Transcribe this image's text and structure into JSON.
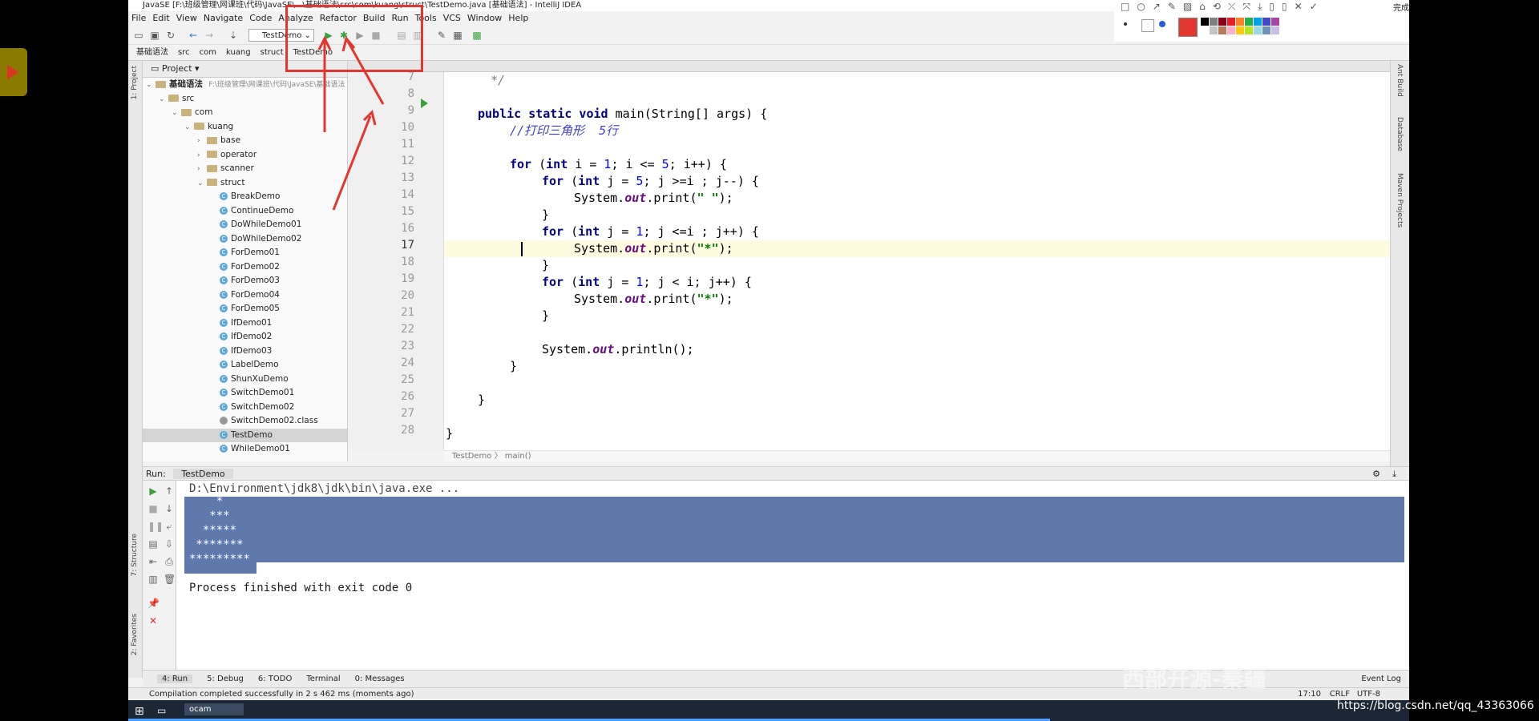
{
  "window": {
    "title": "JavaSE [F:\\班级管理\\网课班\\代码\\JavaSE\\...\\基础语法\\src\\com\\kuang\\struct\\TestDemo.java [基础语法] - IntelliJ IDEA"
  },
  "menu": [
    "File",
    "Edit",
    "View",
    "Navigate",
    "Code",
    "Analyze",
    "Refactor",
    "Build",
    "Run",
    "Tools",
    "VCS",
    "Window",
    "Help"
  ],
  "toolbar": {
    "run_config": "TestDemo"
  },
  "breadcrumb": [
    "基础语法",
    "src",
    "com",
    "kuang",
    "struct",
    "TestDemo"
  ],
  "project_panel": {
    "header": "Project",
    "root": "基础语法",
    "root_path": "F:\\班级管理\\网课班\\代码\\JavaSE\\基础语法",
    "tree": [
      {
        "label": "src",
        "type": "folder",
        "indent": 1
      },
      {
        "label": "com",
        "type": "folder",
        "indent": 2
      },
      {
        "label": "kuang",
        "type": "folder",
        "indent": 3
      },
      {
        "label": "base",
        "type": "folder",
        "indent": 4
      },
      {
        "label": "operator",
        "type": "folder",
        "indent": 4
      },
      {
        "label": "scanner",
        "type": "folder",
        "indent": 4
      },
      {
        "label": "struct",
        "type": "folder",
        "indent": 4
      },
      {
        "label": "BreakDemo",
        "type": "class",
        "indent": 5
      },
      {
        "label": "ContinueDemo",
        "type": "class",
        "indent": 5
      },
      {
        "label": "DoWhileDemo01",
        "type": "class",
        "indent": 5
      },
      {
        "label": "DoWhileDemo02",
        "type": "class",
        "indent": 5
      },
      {
        "label": "ForDemo01",
        "type": "class",
        "indent": 5
      },
      {
        "label": "ForDemo02",
        "type": "class",
        "indent": 5
      },
      {
        "label": "ForDemo03",
        "type": "class",
        "indent": 5
      },
      {
        "label": "ForDemo04",
        "type": "class",
        "indent": 5
      },
      {
        "label": "ForDemo05",
        "type": "class",
        "indent": 5
      },
      {
        "label": "IfDemo01",
        "type": "class",
        "indent": 5
      },
      {
        "label": "IfDemo02",
        "type": "class",
        "indent": 5
      },
      {
        "label": "IfDemo03",
        "type": "class",
        "indent": 5
      },
      {
        "label": "LabelDemo",
        "type": "class",
        "indent": 5
      },
      {
        "label": "ShunXuDemo",
        "type": "class",
        "indent": 5
      },
      {
        "label": "SwitchDemo01",
        "type": "class",
        "indent": 5
      },
      {
        "label": "SwitchDemo02",
        "type": "class",
        "indent": 5
      },
      {
        "label": "SwitchDemo02.class",
        "type": "file",
        "indent": 5
      },
      {
        "label": "TestDemo",
        "type": "class",
        "indent": 5,
        "selected": true
      },
      {
        "label": "WhileDemo01",
        "type": "class",
        "indent": 5
      }
    ]
  },
  "editor": {
    "line_numbers": [
      "7",
      "8",
      "9",
      "10",
      "11",
      "12",
      "13",
      "14",
      "15",
      "16",
      "17",
      "18",
      "19",
      "20",
      "21",
      "22",
      "23",
      "24",
      "25",
      "26",
      "27",
      "28"
    ],
    "current_line": "17",
    "footer": [
      "TestDemo",
      "main()"
    ]
  },
  "run_panel": {
    "tab_label": "Run:",
    "config": "TestDemo",
    "output": [
      "D:\\Environment\\jdk8\\jdk\\bin\\java.exe ...",
      "    *",
      "   ***",
      "  *****",
      " *******",
      "*********",
      "",
      "Process finished with exit code 0"
    ]
  },
  "tool_tabs": [
    "4: Run",
    "5: Debug",
    "6: TODO",
    "Terminal",
    "0: Messages"
  ],
  "event_log": "Event Log",
  "status": {
    "message": "Compilation completed successfully in 2 s 462 ms (moments ago)",
    "position": "17:10",
    "line_sep": "CRLF",
    "encoding": "UTF-8"
  },
  "side_labels": [
    "1: Project",
    "7: Structure",
    "2: Favorites",
    "Ant Build",
    "Database",
    "Maven Projects"
  ],
  "taskbar": {
    "app": "ocam"
  },
  "annotation": {
    "done": "完成",
    "palette": [
      "#000000",
      "#7f7f7f",
      "#880015",
      "#ed1c24",
      "#ff7f27",
      "#22b14c",
      "#00a2e8",
      "#3f48cc",
      "#a349a4",
      "#ffffff",
      "#c3c3c3",
      "#b97a57",
      "#ffaec9",
      "#ffc90e",
      "#b5e61d",
      "#99d9ea",
      "#7092be",
      "#c8bfe7"
    ],
    "current": "#e2362f"
  },
  "watermark": "https://blog.csdn.net/qq_43363066",
  "watermark_cn": "西部开源-秦疆"
}
